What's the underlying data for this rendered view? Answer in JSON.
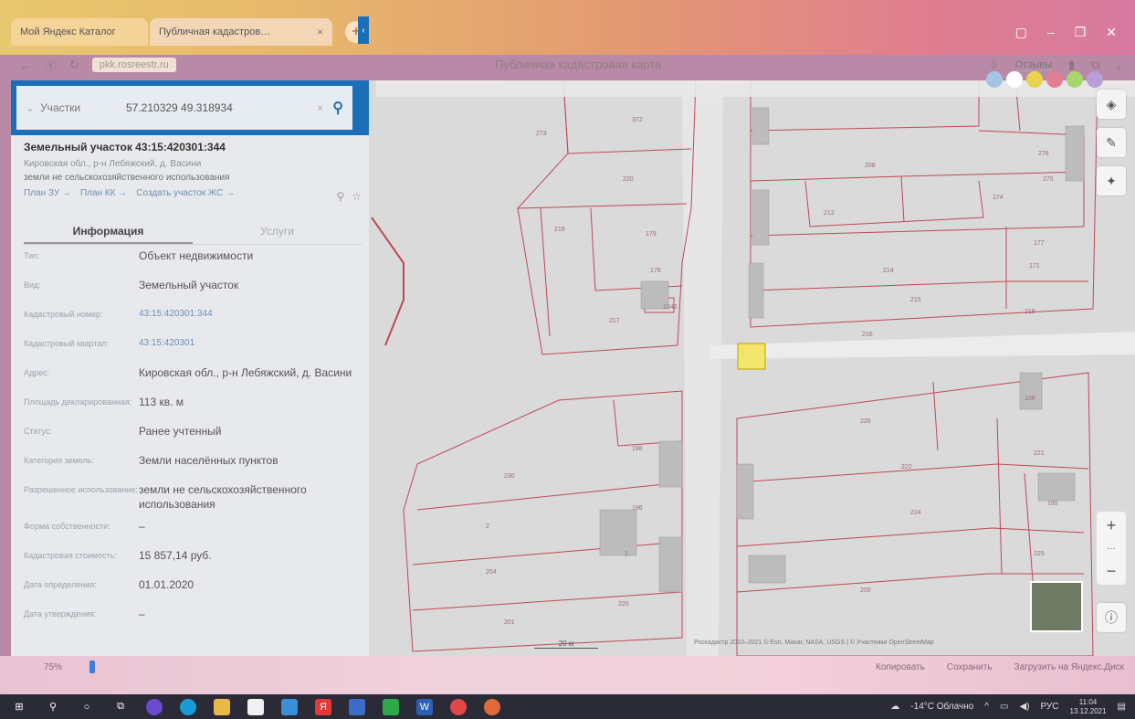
{
  "browser": {
    "tabs": [
      {
        "label": "Мой Яндекс Каталог",
        "close": ""
      },
      {
        "label": "Публичная кадастров…",
        "close": "×"
      }
    ],
    "new_tab": "+",
    "url": "pkk.rosreestr.ru",
    "page_title": "Публичная кадастровая карта",
    "feedback": "Отзывы"
  },
  "search": {
    "type_label": "Участки",
    "value": "57.210329 49.318934",
    "clear": "×",
    "search_glyph": "⚲"
  },
  "object": {
    "title": "Земельный участок 43:15:420301:344",
    "address_short": "Кировская обл., р-н Лебяжский, д. Васини",
    "purpose": "земли не сельскохозяйственного использования",
    "links": [
      "План ЗУ →",
      "План КК →",
      "Создать участок ЖС →"
    ]
  },
  "info_tabs": {
    "info": "Информация",
    "coupons": "Услуги"
  },
  "properties": [
    {
      "label": "Тип:",
      "value": "Объект недвижимости"
    },
    {
      "label": "Вид:",
      "value": "Земельный участок"
    },
    {
      "label": "Кадастровый номер:",
      "value": "43:15:420301:344"
    },
    {
      "label": "Кадастровый квартал:",
      "value": "43:15:420301"
    },
    {
      "label": "Адрес:",
      "value": "Кировская обл., р-н Лебяжский, д. Васини"
    },
    {
      "label": "Площадь декларированная:",
      "value": "113 кв. м"
    },
    {
      "label": "Статус:",
      "value": "Ранее учтенный"
    },
    {
      "label": "Категория земель:",
      "value": "Земли населённых пунктов"
    },
    {
      "label": "Разрешенное использование:",
      "value": "земли не сельскохозяйственного использования"
    },
    {
      "label": "Форма собственности:",
      "value": "–"
    },
    {
      "label": "Кадастровая стоимость:",
      "value": "15 857,14 руб."
    },
    {
      "label": "Дата определения:",
      "value": "01.01.2020"
    },
    {
      "label": "Дата утверждения:",
      "value": "–"
    }
  ],
  "map": {
    "parcel_labels": [
      "372",
      "273",
      "220",
      "219",
      "179",
      "178",
      "217",
      "1346",
      "216",
      "208",
      "212",
      "214",
      "215",
      "218",
      "276",
      "275",
      "274",
      "177",
      "171",
      "109",
      "221",
      "195",
      "226",
      "222",
      "224",
      "225",
      "200",
      "198",
      "230",
      "196",
      "2",
      "1",
      "204",
      "220",
      "201"
    ],
    "scale": "20 м",
    "copyright": "Роскадастр 2010–2021 © Esri, Maxar, NASA, USGS | © Участники OpenStreetMap",
    "zoom_in": "+",
    "zoom_out": "−",
    "zoom_mid": "···"
  },
  "statusbar": {
    "zoom_level": "75%",
    "actions": [
      "Копировать",
      "Сохранить",
      "Загрузить на Яндекс.Диск"
    ]
  },
  "taskbar": {
    "weather": "-14°C Облачно",
    "lang": "РУС",
    "time": "11:04",
    "date": "13.12.2021"
  },
  "colors": {
    "accent": "#1a6fb8",
    "parcel_border": "#c0485a",
    "selected_parcel": "#f1e56b"
  }
}
